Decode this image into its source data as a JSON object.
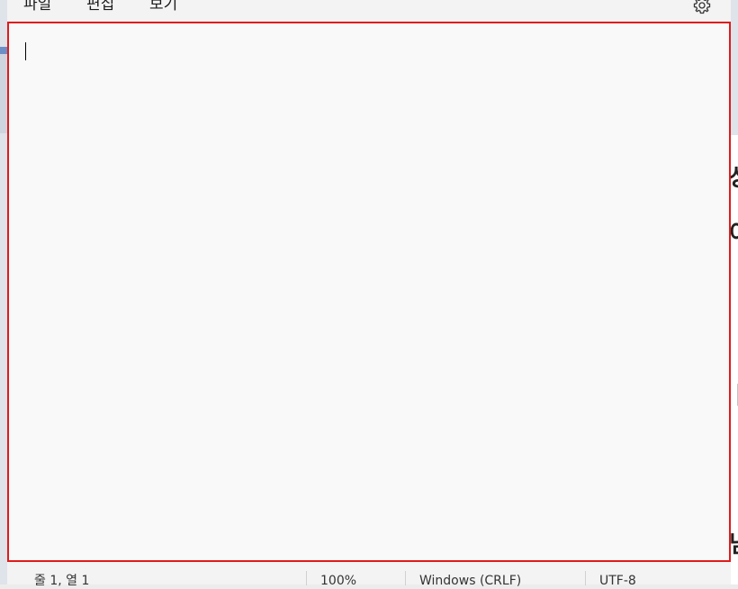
{
  "background": {
    "right_glyphs": [
      "상",
      "이",
      "ㅏ",
      "님"
    ]
  },
  "menu": {
    "file": "파일",
    "edit": "편집",
    "view": "보기"
  },
  "settings": {
    "icon": "gear-icon"
  },
  "editor": {
    "content": "",
    "border_color": "#e01b1b"
  },
  "status": {
    "position": "줄 1, 열 1",
    "zoom": "100%",
    "line_ending": "Windows (CRLF)",
    "encoding": "UTF-8"
  }
}
